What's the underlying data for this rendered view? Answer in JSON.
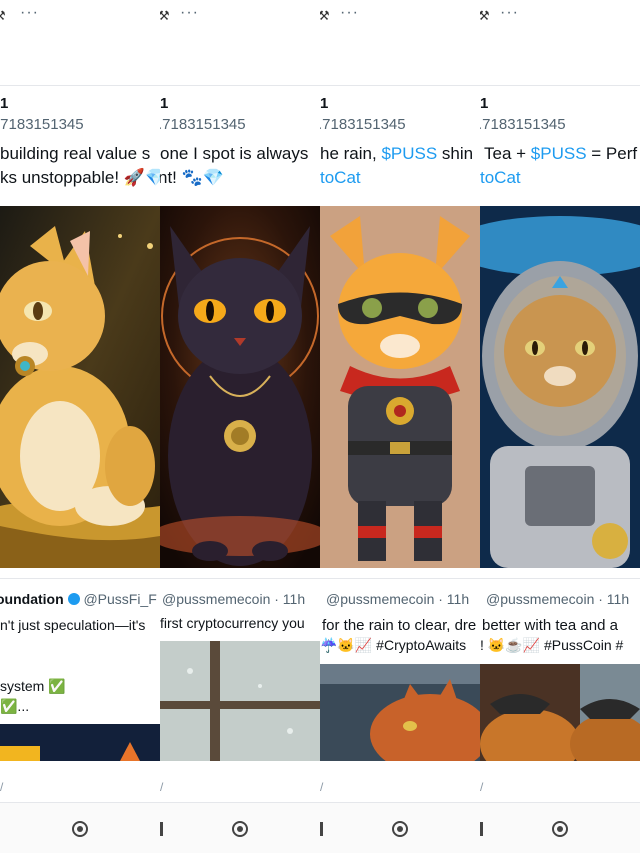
{
  "columns": [
    {
      "top_symbol": "⚒",
      "top_dots": "···",
      "count": "1",
      "address": ".7183151345",
      "line1": "building real value s",
      "line2": "ks unstoppable! 🚀💎",
      "header_name": "oundation",
      "header_handle": "@PussFi_F",
      "t2_line1": "n't just speculation—it's",
      "t2_line2": "",
      "t2_line3": "system ✅",
      "t2_line4": "✅...",
      "footer_mark": "/"
    },
    {
      "top_symbol": "⚒",
      "top_dots": "···",
      "count": "1",
      "address": ".7183151345",
      "line1": "one I spot is always",
      "line2": "nt! 🐾💎",
      "header_handle": "@pussmemecoin · 11h",
      "t2_line1": "first cryptocurrency you",
      "footer_mark": "/"
    },
    {
      "top_symbol": "⚒",
      "top_dots": "···",
      "count": "1",
      "address": ".7183151345",
      "line1_a": "he rain, ",
      "line1_link": "$PUSS",
      "line1_b": " shin",
      "line2_link": "toCat",
      "header_handle": "@pussmemecoin · 11h",
      "t2_line1": "for the rain to clear, dre",
      "t2_line2": "☔🐱📈 #CryptoAwaits",
      "footer_mark": "/"
    },
    {
      "top_symbol": "⚒",
      "top_dots": "···",
      "count": "1",
      "address": ".7183151345",
      "line1_a": "Tea + ",
      "line1_link": "$PUSS",
      "line1_b": " = Perf",
      "line2_link": "toCat",
      "header_handle": "@pussmemecoin · 11h",
      "t2_line1": "better with tea and a",
      "t2_line2": "! 🐱☕📈 #PussCoin #",
      "footer_mark": "/"
    }
  ],
  "colors": {
    "link": "#1d9bf0",
    "muted": "#536471",
    "text": "#0f1419"
  },
  "icons": [
    "hammer-icon",
    "more-icon",
    "verified-icon",
    "back-nav-icon",
    "home-nav-icon"
  ]
}
